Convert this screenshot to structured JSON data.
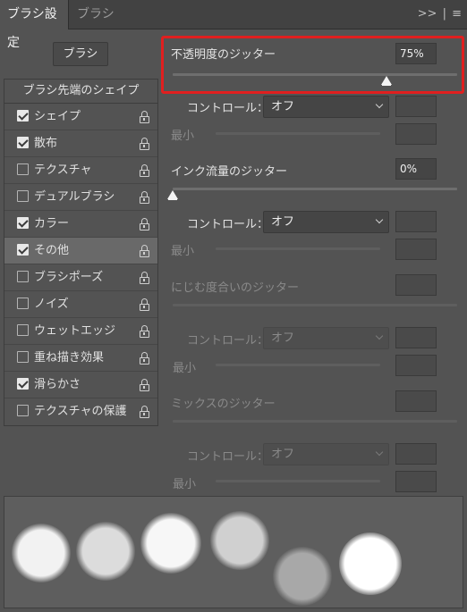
{
  "tabs": [
    {
      "label": "ブラシ設定",
      "active": true
    },
    {
      "label": "ブラシ",
      "active": false
    }
  ],
  "panel_menu": {
    "collapse": ">>",
    "divider": "|",
    "menu": "≡"
  },
  "brush_button": "ブラシ",
  "list": {
    "header": "ブラシ先端のシェイプ",
    "items": [
      {
        "label": "シェイプ",
        "checked": true,
        "selected": false
      },
      {
        "label": "散布",
        "checked": true,
        "selected": false
      },
      {
        "label": "テクスチャ",
        "checked": false,
        "selected": false
      },
      {
        "label": "デュアルブラシ",
        "checked": false,
        "selected": false
      },
      {
        "label": "カラー",
        "checked": true,
        "selected": false
      },
      {
        "label": "その他",
        "checked": true,
        "selected": true
      },
      {
        "label": "ブラシポーズ",
        "checked": false,
        "selected": false
      },
      {
        "label": "ノイズ",
        "checked": false,
        "selected": false
      },
      {
        "label": "ウェットエッジ",
        "checked": false,
        "selected": false
      },
      {
        "label": "重ね描き効果",
        "checked": false,
        "selected": false
      },
      {
        "label": "滑らかさ",
        "checked": true,
        "selected": false
      },
      {
        "label": "テクスチャの保護",
        "checked": false,
        "selected": false
      }
    ]
  },
  "opacity_jitter": {
    "label": "不透明度のジッター",
    "value": "75%",
    "level": 0.75,
    "control_label": "コントロール：",
    "control_value": "オフ",
    "min_label": "最小"
  },
  "flow_jitter": {
    "label": "インク流量のジッター",
    "value": "0%",
    "level": 0.0,
    "control_label": "コントロール：",
    "control_value": "オフ",
    "min_label": "最小"
  },
  "wet_jitter": {
    "label": "にじむ度合いのジッター",
    "control_label": "コントロール：",
    "control_value": "オフ",
    "min_label": "最小"
  },
  "mix_jitter": {
    "label": "ミックスのジッター",
    "control_label": "コントロール：",
    "control_value": "オフ",
    "min_label": "最小"
  },
  "colors": {
    "highlight": "#e01f1f",
    "panel": "#535353",
    "tabbar": "#424242"
  }
}
